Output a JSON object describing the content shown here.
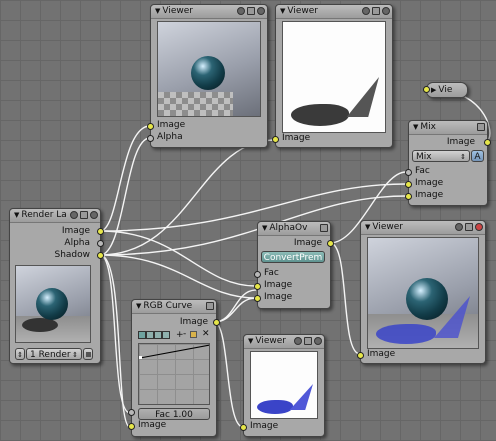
{
  "nodes": {
    "viewer1": {
      "title": "Viewer",
      "inputs": [
        "Image",
        "Alpha"
      ]
    },
    "viewer2": {
      "title": "Viewer",
      "inputs": [
        "Image"
      ]
    },
    "viewer_small": {
      "title": "Vie"
    },
    "mix": {
      "title": "Mix",
      "output": "Image",
      "mode": "Mix",
      "alpha_button": "A",
      "inputs": [
        "Fac",
        "Image",
        "Image"
      ]
    },
    "render_layers": {
      "title": "Render La",
      "outputs": [
        "Image",
        "Alpha",
        "Shadow"
      ],
      "layer": "1 Render"
    },
    "alpha_over": {
      "title": "AlphaOv",
      "output": "Image",
      "convert_button": "ConvertPrem",
      "inputs": [
        "Fac",
        "Image",
        "Image"
      ]
    },
    "viewer3": {
      "title": "Viewer",
      "inputs": [
        "Image"
      ]
    },
    "rgb_curves": {
      "title": "RGB Curve",
      "output": "Image",
      "channels": [
        "C",
        "R",
        "G",
        "B"
      ],
      "fac": "Fac 1.00",
      "input": "Image"
    },
    "viewer4": {
      "title": "Viewer",
      "inputs": [
        "Image"
      ]
    }
  },
  "colors": {
    "background": "#727272",
    "node_body": "#a8a8a8",
    "socket_image": "#e6e64a",
    "socket_value": "#b8b8b8",
    "wire": "#ffffff",
    "convert_button": "#6fa3a0"
  },
  "icons": [
    "collapse-triangle-icon",
    "node-hide-icon",
    "node-preview-toggle-icon",
    "node-close-icon",
    "zoom-in-icon",
    "zoom-out-icon",
    "clipping-icon",
    "delete-icon",
    "browse-layer-icon"
  ]
}
